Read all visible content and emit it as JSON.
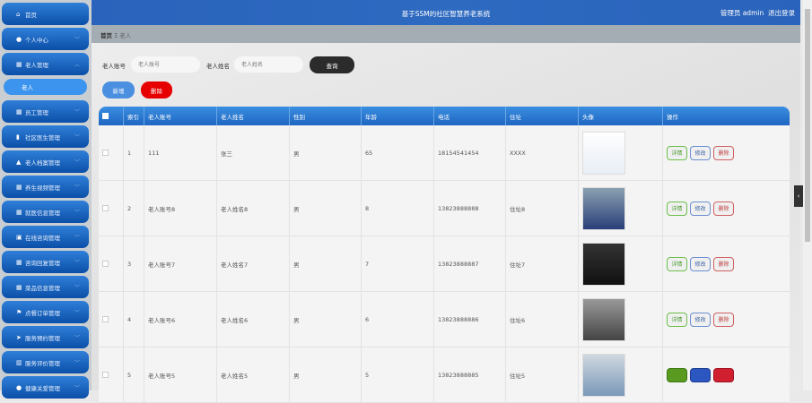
{
  "header": {
    "title": "基于SSM的社区智慧养老系统",
    "user": "管理员 admin",
    "logout": "退出登录"
  },
  "breadcrumb": {
    "home": "首页",
    "sep": "Ξ",
    "current": "老人"
  },
  "sidebar": {
    "items": [
      {
        "label": "首页",
        "icon": "home-icon",
        "chev": false
      },
      {
        "label": "个人中心",
        "icon": "user-icon",
        "chev": true
      },
      {
        "label": "老人管理",
        "icon": "grid-icon",
        "chev": true,
        "expanded": true
      },
      {
        "label": "员工管理",
        "icon": "grid-icon",
        "chev": true
      },
      {
        "label": "社区医生管理",
        "icon": "book-icon",
        "chev": true
      },
      {
        "label": "老人档案管理",
        "icon": "stamp-icon",
        "chev": true
      },
      {
        "label": "养生视频管理",
        "icon": "grid-icon",
        "chev": true
      },
      {
        "label": "就医信息管理",
        "icon": "grid-icon",
        "chev": true
      },
      {
        "label": "在线咨询管理",
        "icon": "clipboard-icon",
        "chev": true
      },
      {
        "label": "咨询回复管理",
        "icon": "grid-icon",
        "chev": true
      },
      {
        "label": "菜品信息管理",
        "icon": "grid-icon",
        "chev": true
      },
      {
        "label": "点餐订单管理",
        "icon": "flag-icon",
        "chev": true
      },
      {
        "label": "服务预约管理",
        "icon": "send-icon",
        "chev": true
      },
      {
        "label": "服务评价管理",
        "icon": "chart-icon",
        "chev": true
      },
      {
        "label": "健康关爱管理",
        "icon": "user-icon",
        "chev": true
      }
    ],
    "sub": "老人"
  },
  "search": {
    "account_label": "老人账号",
    "account_placeholder": "老人账号",
    "name_label": "老人姓名",
    "name_placeholder": "老人姓名",
    "query": "查询"
  },
  "actions": {
    "add": "新增",
    "delete": "删除"
  },
  "table": {
    "columns": [
      "索引",
      "老人账号",
      "老人姓名",
      "性别",
      "年龄",
      "电话",
      "住址",
      "头像",
      "操作"
    ],
    "rows": [
      {
        "idx": "1",
        "account": "111",
        "name": "张三",
        "gender": "男",
        "age": "65",
        "phone": "18154541454",
        "addr": "XXXX"
      },
      {
        "idx": "2",
        "account": "老人账号8",
        "name": "老人姓名8",
        "gender": "男",
        "age": "8",
        "phone": "13823888888",
        "addr": "住址8"
      },
      {
        "idx": "3",
        "account": "老人账号7",
        "name": "老人姓名7",
        "gender": "男",
        "age": "7",
        "phone": "13823888887",
        "addr": "住址7"
      },
      {
        "idx": "4",
        "account": "老人账号6",
        "name": "老人姓名6",
        "gender": "男",
        "age": "6",
        "phone": "13823888886",
        "addr": "住址6"
      },
      {
        "idx": "5",
        "account": "老人账号5",
        "name": "老人姓名5",
        "gender": "男",
        "age": "5",
        "phone": "13823888885",
        "addr": "住址5"
      }
    ],
    "ops": {
      "detail": "详情",
      "edit": "修改",
      "delete": "删除"
    }
  },
  "colors": {
    "header": "#2a63bb",
    "sidebar": "#0b4fa8",
    "add": "#4a8fe0",
    "delete": "#e60000",
    "query": "#2b2b2b"
  }
}
